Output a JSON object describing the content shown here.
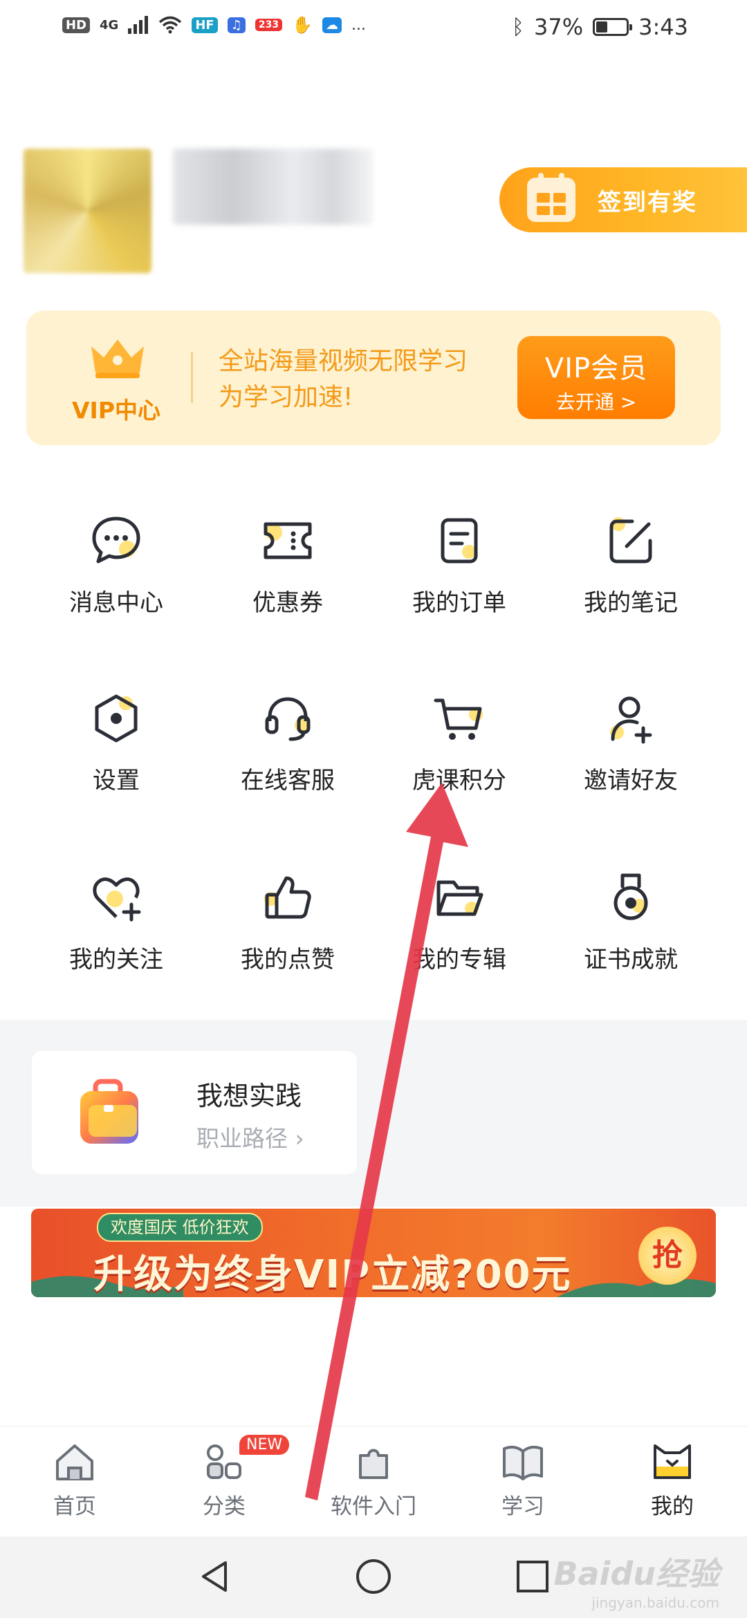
{
  "status_bar": {
    "left_icons": [
      "HD",
      "4G",
      "signal-icon",
      "wifi-icon",
      "HF",
      "music-icon",
      "233",
      "hand-icon",
      "weather-icon",
      "..."
    ],
    "bluetooth": "bluetooth-icon",
    "battery_percent": "37%",
    "battery_level": 0.37,
    "time": "3:43"
  },
  "profile": {
    "checkin_label": "签到有奖"
  },
  "vip": {
    "center_label": "VIP中心",
    "promo_line1": "全站海量视频无限学习",
    "promo_line2": "为学习加速!",
    "button_title": "VIP会员",
    "button_sub": "去开通 >"
  },
  "grid": [
    {
      "label": "消息中心",
      "icon": "message-icon"
    },
    {
      "label": "优惠券",
      "icon": "coupon-icon"
    },
    {
      "label": "我的订单",
      "icon": "order-icon"
    },
    {
      "label": "我的笔记",
      "icon": "note-icon"
    },
    {
      "label": "设置",
      "icon": "settings-icon"
    },
    {
      "label": "在线客服",
      "icon": "headset-icon"
    },
    {
      "label": "虎课积分",
      "icon": "cart-icon"
    },
    {
      "label": "邀请好友",
      "icon": "invite-icon"
    },
    {
      "label": "我的关注",
      "icon": "heart-add-icon"
    },
    {
      "label": "我的点赞",
      "icon": "thumbs-up-icon"
    },
    {
      "label": "我的专辑",
      "icon": "folder-icon"
    },
    {
      "label": "证书成就",
      "icon": "medal-icon"
    }
  ],
  "practice": {
    "title": "我想实践",
    "subtitle": "职业路径"
  },
  "banner": {
    "tag": "欢度国庆 低价狂欢",
    "main": "升级为终身VIP立减?00元",
    "grab": "抢"
  },
  "bottom_nav": [
    {
      "label": "首页",
      "icon": "home-icon"
    },
    {
      "label": "分类",
      "icon": "category-icon",
      "badge": "NEW"
    },
    {
      "label": "软件入门",
      "icon": "puzzle-icon"
    },
    {
      "label": "学习",
      "icon": "book-icon"
    },
    {
      "label": "我的",
      "icon": "cat-icon"
    }
  ],
  "watermark": {
    "brand": "Baidu经验",
    "site": "jingyan.baidu.com"
  },
  "colors": {
    "accent_orange": "#ffa31a",
    "vip_card_bg": "#fff2d1",
    "arrow_red": "#e5384a",
    "icon_dark": "#2b2e36",
    "icon_highlight": "#ffe27a"
  }
}
